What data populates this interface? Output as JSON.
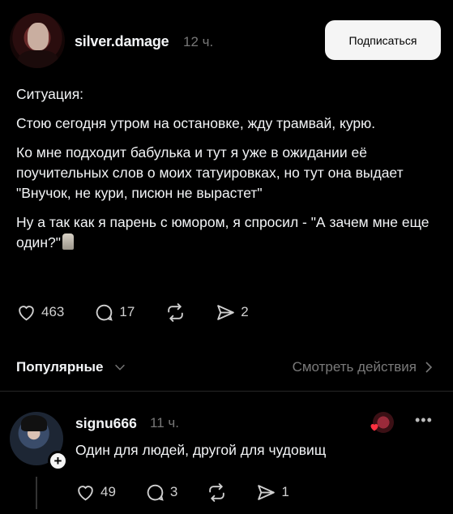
{
  "post": {
    "username": "silver.damage",
    "time": "12 ч.",
    "follow_label": "Подписаться",
    "paragraphs": [
      "Ситуация:",
      "Стою сегодня утром на остановке, жду трамвай, курю.",
      "Ко мне подходит бабулька и тут я уже в ожидании её поучительных слов о моих татуировках, но тут она выдает \"Внучок, не кури, писюн не вырастет\"",
      "Ну а так как я парень с юмором, я спросил - \"А зачем мне еще один?\""
    ],
    "emoji_icon": "moai-emoji",
    "likes": "463",
    "comments": "17",
    "shares": "2"
  },
  "sort": {
    "label": "Популярные",
    "activity_link": "Смотреть действия"
  },
  "reply": {
    "username": "signu666",
    "time": "11 ч.",
    "text": "Один для людей, другой для чудовищ",
    "more": "•••",
    "likes": "49",
    "comments": "3",
    "shares": "1"
  },
  "colors": {
    "background": "#000000",
    "text": "#f3f5f7",
    "muted": "#777777",
    "button_bg": "#f5f5f5",
    "heart_red": "#ff3040"
  }
}
